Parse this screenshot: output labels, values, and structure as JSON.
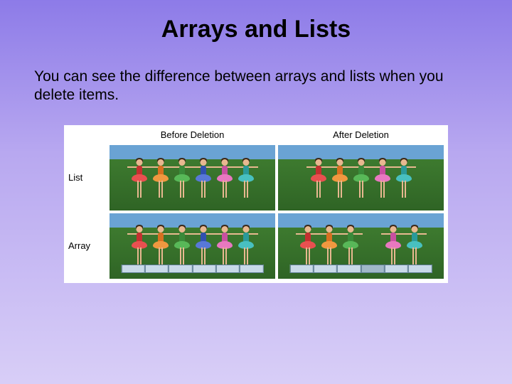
{
  "title": "Arrays and Lists",
  "body": "You can see the difference between arrays and lists when you delete items.",
  "figure": {
    "columns": [
      "Before Deletion",
      "After Deletion"
    ],
    "rows": [
      "List",
      "Array"
    ],
    "cells": {
      "list_before": {
        "platform": false,
        "dancers": [
          "red",
          "orange",
          "green",
          "blue",
          "pink",
          "teal"
        ]
      },
      "list_after": {
        "platform": false,
        "dancers": [
          "red",
          "orange",
          "green",
          "pink",
          "teal"
        ]
      },
      "array_before": {
        "platform": true,
        "slots": 6,
        "dancers": [
          "red",
          "orange",
          "green",
          "blue",
          "pink",
          "teal"
        ]
      },
      "array_after": {
        "platform": true,
        "slots": 6,
        "dancers": [
          "red",
          "orange",
          "green",
          null,
          "pink",
          "teal"
        ]
      }
    }
  }
}
